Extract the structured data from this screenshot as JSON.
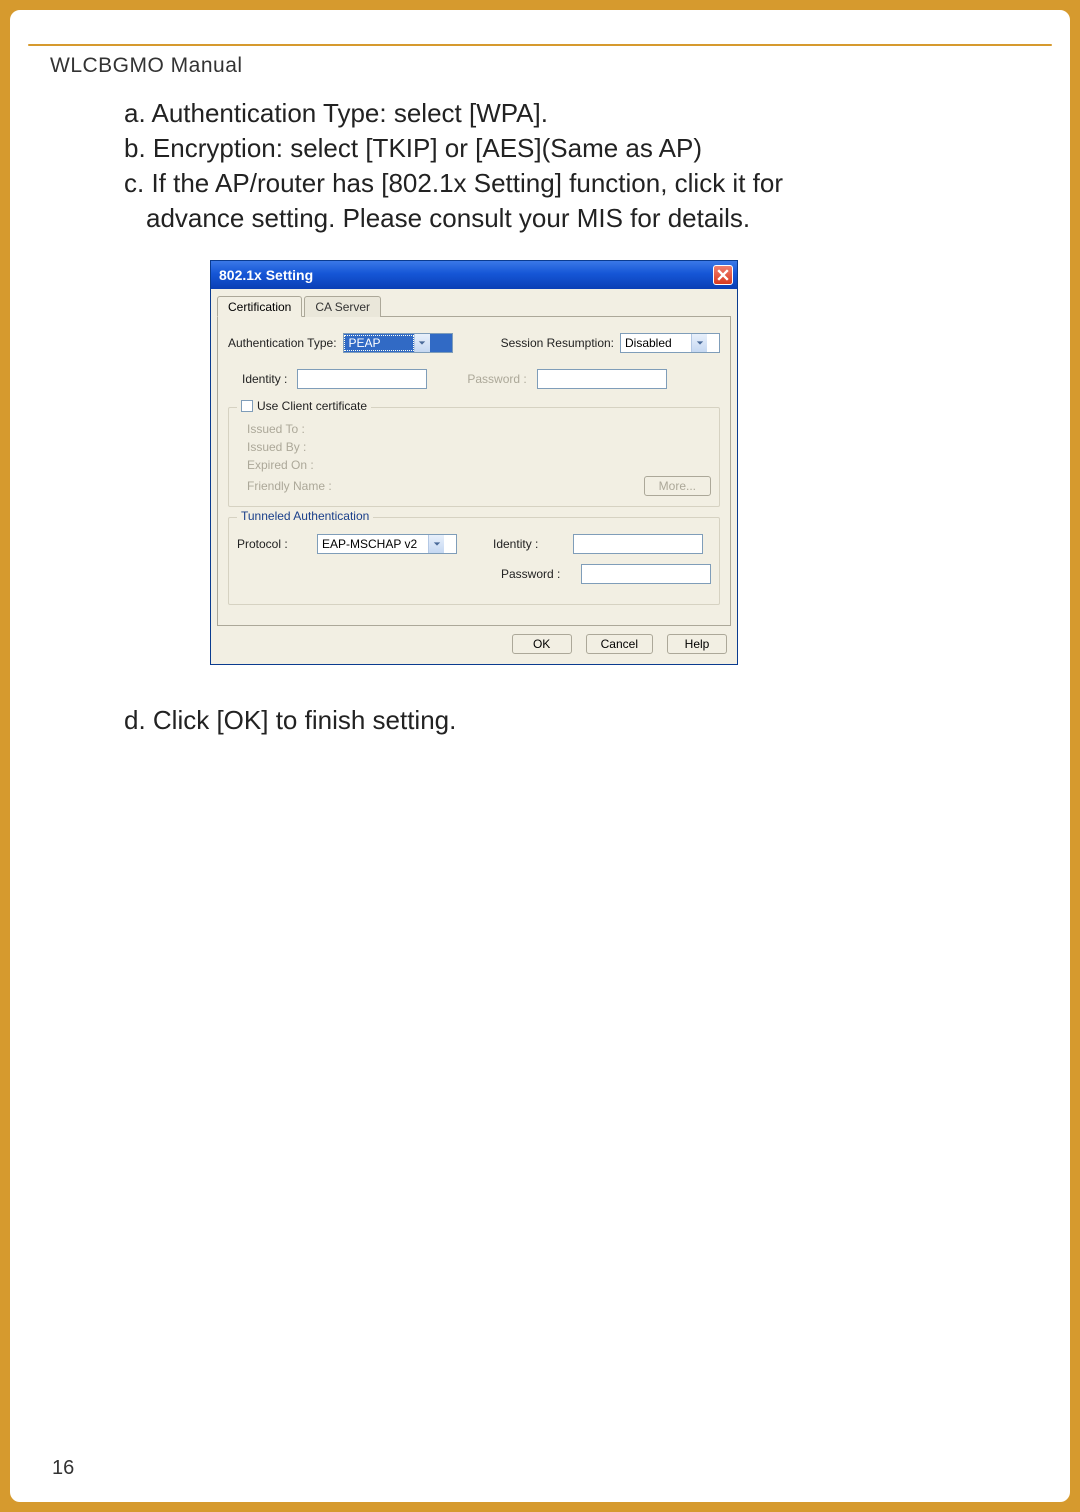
{
  "header": {
    "manual_title": "WLCBGMO  Manual"
  },
  "instructions": {
    "a": "a. Authentication Type: select [WPA].",
    "b": "b. Encryption: select [TKIP] or [AES](Same as AP)",
    "c1": "c. If the AP/router has [802.1x Setting] function, click it for",
    "c2": "advance setting. Please consult your MIS for details.",
    "d": "d. Click [OK] to finish setting."
  },
  "dialog": {
    "title": "802.1x Setting",
    "tabs": {
      "certification": "Certification",
      "ca_server": "CA Server"
    },
    "auth_type_label": "Authentication Type:",
    "auth_type_value": "PEAP",
    "session_label": "Session Resumption:",
    "session_value": "Disabled",
    "identity_label": "Identity :",
    "password_label": "Password :",
    "client_cert": {
      "checkbox_label": "Use Client certificate",
      "issued_to": "Issued To :",
      "issued_by": "Issued By :",
      "expired_on": "Expired On :",
      "friendly_name": "Friendly Name :",
      "more_button": "More..."
    },
    "tunneled": {
      "legend": "Tunneled Authentication",
      "protocol_label": "Protocol :",
      "protocol_value": "EAP-MSCHAP v2",
      "identity_label": "Identity :",
      "password_label": "Password :"
    },
    "buttons": {
      "ok": "OK",
      "cancel": "Cancel",
      "help": "Help"
    }
  },
  "page_number": "16"
}
